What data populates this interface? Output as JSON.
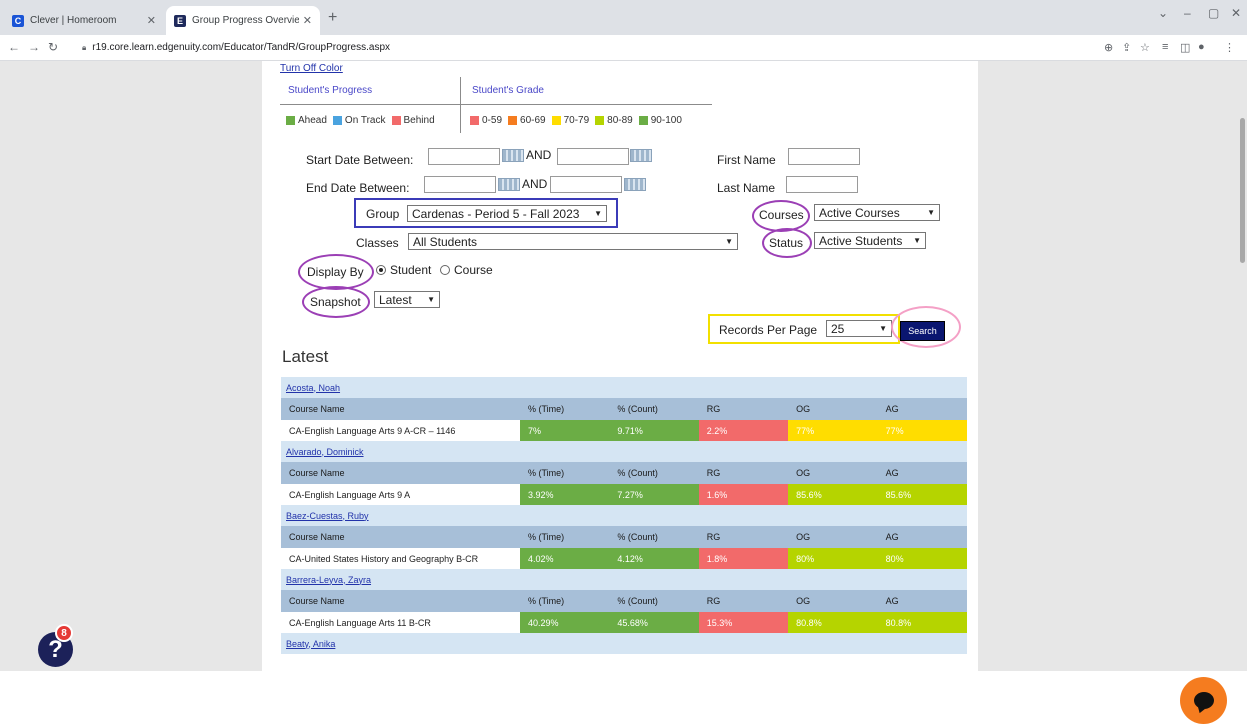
{
  "browser": {
    "tabs": [
      {
        "title": "Clever | Homeroom",
        "favicon": "C",
        "favicon_color": "#1a54d6"
      },
      {
        "title": "Group Progress Overview - Imag",
        "favicon": "E",
        "favicon_color": "#1f2a5c"
      }
    ],
    "url": "r19.core.learn.edgenuity.com/Educator/TandR/GroupProgress.aspx"
  },
  "legend": {
    "turn_off_color": "Turn Off Color",
    "progress_heading": "Student's Progress",
    "grade_heading": "Student's Grade",
    "progress_items": [
      {
        "label": "Ahead",
        "color": "#6bad45"
      },
      {
        "label": "On Track",
        "color": "#4aa3df"
      },
      {
        "label": "Behind",
        "color": "#f26a6a"
      }
    ],
    "grade_items": [
      {
        "label": "0-59",
        "color": "#f26a6a"
      },
      {
        "label": "60-69",
        "color": "#f57c1f"
      },
      {
        "label": "70-79",
        "color": "#ffdd00"
      },
      {
        "label": "80-89",
        "color": "#b5d400"
      },
      {
        "label": "90-100",
        "color": "#6bad45"
      }
    ]
  },
  "filters": {
    "start_date_label": "Start Date Between:",
    "end_date_label": "End Date Between:",
    "and_label": "AND",
    "first_name_label": "First Name",
    "last_name_label": "Last Name",
    "group_label": "Group",
    "group_value": "Cardenas - Period 5 - Fall 2023",
    "courses_label": "Courses",
    "courses_value": "Active Courses",
    "classes_label": "Classes",
    "classes_value": "All Students",
    "status_label": "Status",
    "status_value": "Active Students",
    "display_by_label": "Display By",
    "display_options": [
      "Student",
      "Course"
    ],
    "snapshot_label": "Snapshot",
    "snapshot_value": "Latest",
    "records_label": "Records Per Page",
    "records_value": "25",
    "search_label": "Search"
  },
  "results": {
    "title": "Latest",
    "columns": [
      "Course Name",
      "% (Time)",
      "% (Count)",
      "RG",
      "OG",
      "AG"
    ],
    "students": [
      {
        "name": "Acosta, Noah",
        "course": "CA-English Language Arts 9 A-CR – 1146",
        "time": "7%",
        "count": "9.71%",
        "rg": "2.2%",
        "og": "77%",
        "ag": "77%",
        "colors": [
          "g-green",
          "g-green",
          "g-red",
          "g-yellow",
          "g-yellow"
        ]
      },
      {
        "name": "Alvarado, Dominick",
        "course": "CA-English Language Arts 9 A",
        "time": "3.92%",
        "count": "7.27%",
        "rg": "1.6%",
        "og": "85.6%",
        "ag": "85.6%",
        "colors": [
          "g-green",
          "g-green",
          "g-red",
          "g-lime",
          "g-lime"
        ]
      },
      {
        "name": "Baez-Cuestas, Ruby",
        "course": "CA-United States History and Geography B-CR",
        "time": "4.02%",
        "count": "4.12%",
        "rg": "1.8%",
        "og": "80%",
        "ag": "80%",
        "colors": [
          "g-green",
          "g-green",
          "g-red",
          "g-lime",
          "g-lime"
        ]
      },
      {
        "name": "Barrera-Leyva, Zayra",
        "course": "CA-English Language Arts 11 B-CR",
        "time": "40.29%",
        "count": "45.68%",
        "rg": "15.3%",
        "og": "80.8%",
        "ag": "80.8%",
        "colors": [
          "g-green",
          "g-green",
          "g-red",
          "g-lime",
          "g-lime"
        ]
      }
    ],
    "last_student": "Beaty, Anika"
  },
  "widgets": {
    "help_badge": "8"
  }
}
